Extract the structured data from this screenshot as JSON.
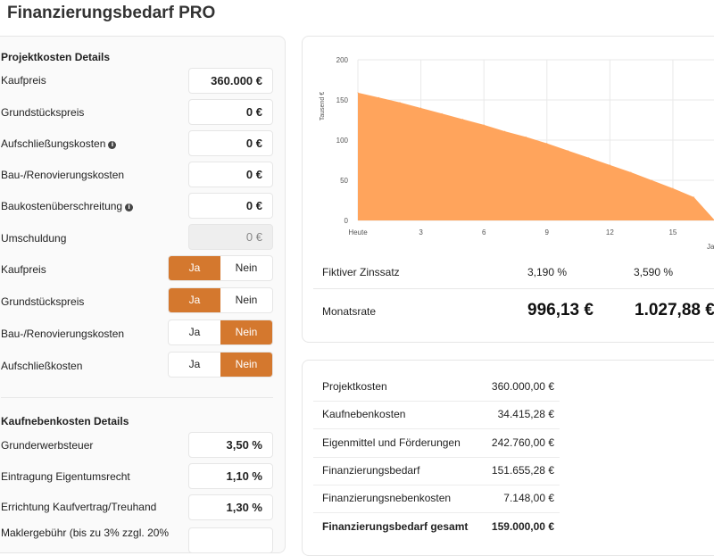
{
  "title": "Finanzierungsbedarf PRO",
  "projekt": {
    "heading": "Projektkosten Details",
    "inputs": [
      {
        "label": "Kaufpreis",
        "value": "360.000 €"
      },
      {
        "label": "Grundstückspreis",
        "value": "0 €"
      },
      {
        "label": "Aufschließungskosten",
        "value": "0 €"
      },
      {
        "label": "Bau-/Renovierungskosten",
        "value": "0 €"
      },
      {
        "label": "Baukostenüberschreitung",
        "value": "0 €"
      },
      {
        "label": "Umschuldung",
        "value": "0 €"
      }
    ],
    "toggles": [
      {
        "label": "Kaufpreis",
        "yes": "Ja",
        "no": "Nein",
        "selected": "Ja"
      },
      {
        "label": "Grundstückspreis",
        "yes": "Ja",
        "no": "Nein",
        "selected": "Ja"
      },
      {
        "label": "Bau-/Renovierungskosten",
        "yes": "Ja",
        "no": "Nein",
        "selected": "Nein"
      },
      {
        "label": "Aufschließkosten",
        "yes": "Ja",
        "no": "Nein",
        "selected": "Nein"
      }
    ]
  },
  "nebenkosten": {
    "heading": "Kaufnebenkosten Details",
    "inputs": [
      {
        "label": "Grunderwerbsteuer",
        "value": "3,50 %"
      },
      {
        "label": "Eintragung Eigentumsrecht",
        "value": "1,10 %"
      },
      {
        "label": "Errichtung Kaufvertrag/Treuhand",
        "value": "1,30 %"
      },
      {
        "label": "Maklergebühr (bis zu 3% zzgl. 20%",
        "value": ""
      }
    ]
  },
  "chart_data": {
    "type": "area",
    "ylabel": "Tausend €",
    "xlabel": "Ja",
    "ylim": [
      0,
      200
    ],
    "y_ticks": [
      "0",
      "50",
      "100",
      "150",
      "200"
    ],
    "x_ticks": [
      "Heute",
      "3",
      "6",
      "9",
      "12",
      "15"
    ],
    "x_tick_values": [
      0,
      3,
      6,
      9,
      12,
      15
    ],
    "xlim": [
      0,
      17
    ],
    "grid": true,
    "color": "#ffa45c",
    "series": [
      {
        "x": [
          0,
          1,
          2,
          3,
          4,
          5,
          6,
          7,
          8,
          9,
          10,
          11,
          12,
          13,
          14,
          15,
          16,
          17
        ],
        "values": [
          159,
          153,
          147,
          140,
          133,
          126,
          119,
          111,
          104,
          96,
          87,
          78,
          69,
          60,
          50,
          40,
          29,
          0
        ]
      }
    ]
  },
  "zinsen": {
    "label": "Fiktiver Zinssatz",
    "values": [
      "3,190 %",
      "3,590 %"
    ]
  },
  "monatsrate": {
    "label": "Monatsrate",
    "values": [
      "996,13 €",
      "1.027,88 €"
    ]
  },
  "summary": [
    {
      "label": "Projektkosten",
      "value": "360.000,00 €"
    },
    {
      "label": "Kaufnebenkosten",
      "value": "34.415,28 €"
    },
    {
      "label": "Eigenmittel und Förderungen",
      "value": "242.760,00 €"
    },
    {
      "label": "Finanzierungsbedarf",
      "value": "151.655,28 €"
    },
    {
      "label": "Finanzierungsnebenkosten",
      "value": "7.148,00 €"
    },
    {
      "label": "Finanzierungsbedarf gesamt",
      "value": "159.000,00 €",
      "bold": true
    }
  ],
  "colors": {
    "accent": "#d4782e",
    "area": "#ffa45c"
  }
}
